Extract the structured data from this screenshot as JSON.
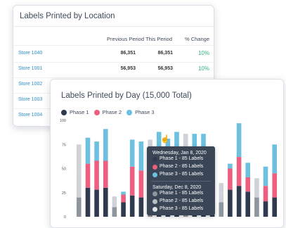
{
  "location_card": {
    "title": "Labels Printed by Location",
    "columns": [
      "Previous Period",
      "This Period",
      "% Change"
    ],
    "rows": [
      {
        "store": "Store 1040",
        "previous": "86,351",
        "current": "86,351",
        "change": "10%"
      },
      {
        "store": "Store 1001",
        "previous": "56,953",
        "current": "56,953",
        "change": "10%"
      },
      {
        "store": "Store 1002",
        "previous": "",
        "current": "",
        "change": ""
      },
      {
        "store": "Store 1003",
        "previous": "",
        "current": "",
        "change": ""
      },
      {
        "store": "Store 1004",
        "previous": "",
        "current": "",
        "change": ""
      }
    ]
  },
  "day_card": {
    "title": "Labels Printed by Day (15,000 Total)"
  },
  "tooltip": {
    "date1": "Wednesday, Jan 8, 2020",
    "items1": [
      "Phase 1 - 85 Labels",
      "Phase 2 - 85 Labels",
      "Phase 3 - 85 Labels"
    ],
    "date2": "Saturday, Dec 8, 2020",
    "items2": [
      "Phase 1 - 85 Labels",
      "Phase 2 - 85 Labels",
      "Phase 3 - 85 Labels"
    ]
  },
  "colors": {
    "phase1": "#2f3a4f",
    "phase2": "#ec5f7f",
    "phase3": "#6cc0e0",
    "inactive": "#cfd3d8",
    "inactive_dark": "#8f959d",
    "link": "#2a8fc7",
    "positive": "#35b37e"
  },
  "chart_data": {
    "type": "bar",
    "stacked": true,
    "series": [
      {
        "name": "Phase 1",
        "values": [
          20,
          30,
          28,
          30,
          10,
          15,
          22,
          20,
          20,
          22,
          28,
          26,
          24,
          24,
          26,
          20,
          15,
          28,
          32,
          26,
          20,
          16,
          20
        ]
      },
      {
        "name": "Phase 2",
        "values": [
          25,
          25,
          30,
          28,
          6,
          8,
          30,
          28,
          28,
          32,
          35,
          32,
          32,
          32,
          30,
          30,
          10,
          22,
          30,
          15,
          10,
          16,
          25
        ]
      },
      {
        "name": "Phase 3",
        "values": [
          30,
          27,
          20,
          33,
          5,
          3,
          28,
          30,
          32,
          34,
          18,
          30,
          30,
          30,
          30,
          15,
          10,
          5,
          35,
          15,
          10,
          20,
          30
        ]
      }
    ],
    "highlighted_index": 7,
    "yticks": [
      0,
      25,
      50,
      75,
      100
    ],
    "ylim": [
      0,
      100
    ],
    "legend": "top-left",
    "grid": false
  }
}
